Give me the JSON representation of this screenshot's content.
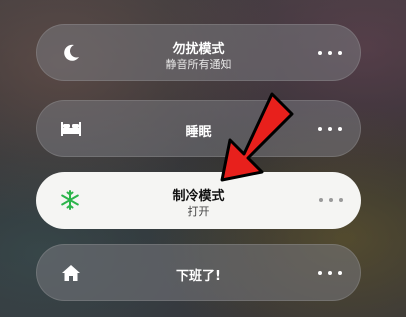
{
  "focus_modes": [
    {
      "title": "勿扰模式",
      "subtitle": "静音所有通知",
      "icon": "moon-icon",
      "active": false
    },
    {
      "title": "睡眠",
      "subtitle": "",
      "icon": "bed-icon",
      "active": false
    },
    {
      "title": "制冷模式",
      "subtitle": "打开",
      "icon": "snowflake-icon",
      "active": true,
      "icon_color": "#2bb44a"
    },
    {
      "title": "下班了!",
      "subtitle": "",
      "icon": "home-icon",
      "active": false
    }
  ],
  "annotation": {
    "arrow_color": "#e8201c",
    "icon": "red-arrow-icon"
  }
}
